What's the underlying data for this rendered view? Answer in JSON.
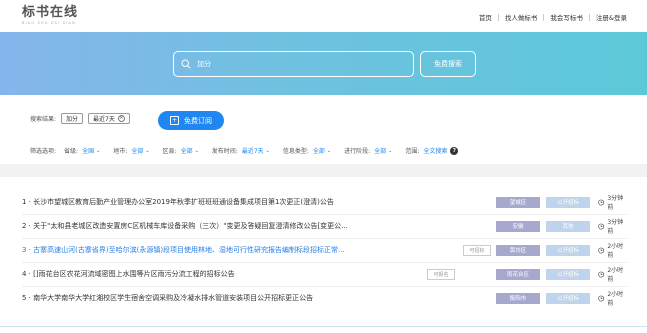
{
  "header": {
    "logo_title": "标书在线",
    "logo_sub": "BIAO SHU ZAI XIAN",
    "nav": [
      "首页",
      "找人做标书",
      "我会写标书",
      "注册&登录"
    ]
  },
  "search": {
    "placeholder": "加分",
    "button": "免费搜索"
  },
  "results": {
    "label": "搜索结果:",
    "tags": [
      "加分",
      "最近7天"
    ],
    "subscribe": "免费订阅"
  },
  "filters": {
    "label": "筛选选项:",
    "groups": [
      {
        "label": "省级:",
        "value": "全国"
      },
      {
        "label": "地市:",
        "value": "全部"
      },
      {
        "label": "区县:",
        "value": "全部"
      },
      {
        "label": "发布时间:",
        "value": "最近7天"
      },
      {
        "label": "信息类型:",
        "value": "全部"
      },
      {
        "label": "进行阶段:",
        "value": "全部"
      },
      {
        "label": "范围:",
        "value": "全文搜索"
      }
    ]
  },
  "items": [
    {
      "title": "1 · 长沙市望城区教育后勤产业管理办公室2019年秋季扩班班班通设备集成项目第1次更正(澄清)公告",
      "bid": "",
      "region": "望城区",
      "kind": "公开招标",
      "time": "3分钟前"
    },
    {
      "title": "2 · 关于\"太和县老城区改造安置房C区机械车库设备采购（三次）\"变更及答疑回复澄清修改公告[变更公...",
      "bid": "",
      "region": "安徽",
      "kind": "其他",
      "time": "3分钟前"
    },
    {
      "title": "3 · 古寨高速山河(古寨省界)至哈尔滨(永源镇)段项目使用林地、湿地可行性研究报告编制标段招标正常...",
      "bid": "可招标",
      "region": "黄坊区",
      "kind": "公开招标",
      "time": "2小时前"
    },
    {
      "title": "4 · []雨花台区农花河流域密图上水围等片区雨污分流工程的招标公告",
      "bid": "可报名",
      "region": "雨花台区",
      "kind": "公开招标",
      "time": "2小时前"
    },
    {
      "title": "5 · 南华大学南华大学红湘校区学生宿舍空调采购及冷凝水排水管道安装项目公开招标更正公告",
      "bid": "",
      "region": "衡阳市",
      "kind": "公开招标",
      "time": "2小时前"
    }
  ],
  "colors": {
    "accent": "#1f86f2",
    "region_bg": "#a6a9cd",
    "kind_bg": "#bfd3ea",
    "active_title": "#2a7de1"
  }
}
